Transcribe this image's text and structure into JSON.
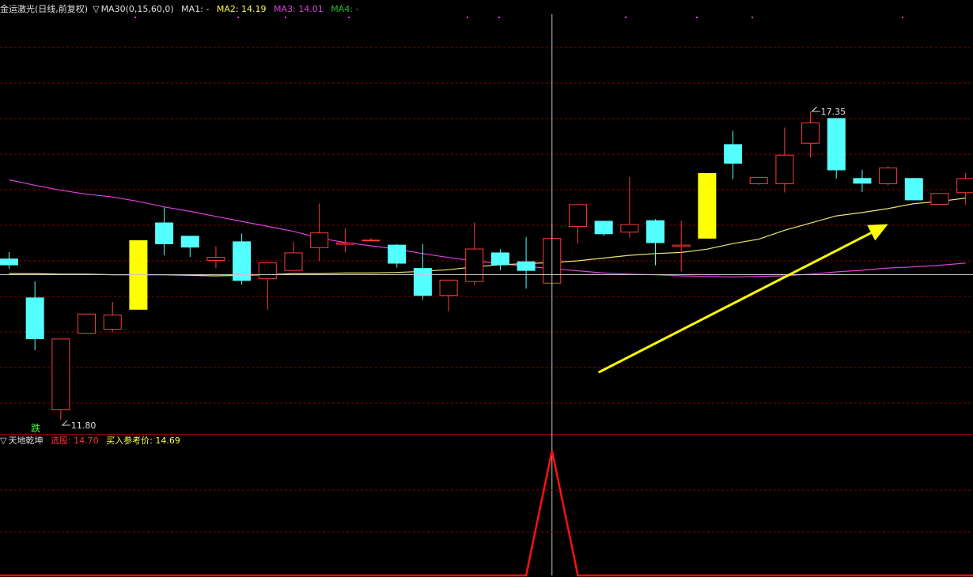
{
  "main_header": {
    "title": "金运激光(日线,前复权)",
    "ma_toggle": "▽",
    "ma_params": "MA30(0,15,60,0)",
    "ma1": "MA1: -",
    "ma2": "MA2: 14.19",
    "ma3": "MA3: 14.01",
    "ma4": "MA4: -"
  },
  "indicator_header": {
    "toggle": "▽",
    "name": "天地乾坤",
    "pick_label": "选股: 14.70",
    "buy_ref_label": "买入参考价: 14.69"
  },
  "annotations": {
    "high_label": "17.35",
    "low_label": "11.80",
    "marker": "跌"
  },
  "colors": {
    "bg": "#000000",
    "grid": "#8b0000",
    "up": "#ff3c3c",
    "down": "#54ffff",
    "big_up": "#ffff00",
    "ma2": "#e8e870",
    "ma3": "#e040e0",
    "ma4": "#20c020",
    "indicator_line": "#ff1010",
    "text_red": "#ff3030",
    "text_yellow": "#ffff40",
    "text_white": "#e0e0e0",
    "marker": "#40ff40"
  },
  "chart_data": [
    {
      "type": "candlestick",
      "price_range": [
        11.6,
        17.6
      ],
      "candles": [
        {
          "o": 14.7,
          "h": 14.82,
          "l": 14.52,
          "c": 14.58
        },
        {
          "o": 14.0,
          "h": 14.29,
          "l": 13.05,
          "c": 13.25
        },
        {
          "o": 11.97,
          "h": 13.26,
          "l": 11.8,
          "c": 13.26
        },
        {
          "o": 13.35,
          "h": 13.7,
          "l": 13.35,
          "c": 13.71
        },
        {
          "o": 13.42,
          "h": 13.92,
          "l": 13.38,
          "c": 13.69
        },
        {
          "o": 13.78,
          "h": 14.99,
          "l": 13.78,
          "c": 15.03
        },
        {
          "o": 15.35,
          "h": 15.62,
          "l": 14.76,
          "c": 14.96
        },
        {
          "o": 15.11,
          "h": 15.11,
          "l": 14.73,
          "c": 14.9
        },
        {
          "o": 14.66,
          "h": 14.92,
          "l": 14.53,
          "c": 14.73
        },
        {
          "o": 15.01,
          "h": 15.15,
          "l": 14.23,
          "c": 14.3
        },
        {
          "o": 14.33,
          "h": 14.63,
          "l": 13.78,
          "c": 14.63
        },
        {
          "o": 14.48,
          "h": 15.0,
          "l": 14.48,
          "c": 14.81
        },
        {
          "o": 14.89,
          "h": 15.69,
          "l": 14.66,
          "c": 15.17
        },
        {
          "o": 14.95,
          "h": 15.25,
          "l": 14.81,
          "c": 14.99
        },
        {
          "o": 15.04,
          "h": 15.07,
          "l": 15.01,
          "c": 15.04
        },
        {
          "o": 14.95,
          "h": 14.96,
          "l": 14.54,
          "c": 14.61
        },
        {
          "o": 14.53,
          "h": 14.96,
          "l": 13.96,
          "c": 14.03
        },
        {
          "o": 14.03,
          "h": 14.32,
          "l": 13.75,
          "c": 14.32
        },
        {
          "o": 14.28,
          "h": 15.35,
          "l": 14.23,
          "c": 14.88
        },
        {
          "o": 14.81,
          "h": 14.87,
          "l": 14.49,
          "c": 14.58
        },
        {
          "o": 14.65,
          "h": 15.09,
          "l": 14.16,
          "c": 14.48
        },
        {
          "o": 14.25,
          "h": 15.32,
          "l": 14.2,
          "c": 15.07
        },
        {
          "o": 15.27,
          "h": 15.53,
          "l": 14.97,
          "c": 15.68
        },
        {
          "o": 15.38,
          "h": 15.36,
          "l": 15.11,
          "c": 15.14
        },
        {
          "o": 15.17,
          "h": 16.17,
          "l": 15.08,
          "c": 15.32
        },
        {
          "o": 15.39,
          "h": 15.41,
          "l": 14.58,
          "c": 14.98
        },
        {
          "o": 14.91,
          "h": 15.38,
          "l": 14.47,
          "c": 14.95
        },
        {
          "o": 15.06,
          "h": 16.24,
          "l": 15.06,
          "c": 16.24
        },
        {
          "o": 16.76,
          "h": 17.0,
          "l": 16.13,
          "c": 16.41
        },
        {
          "o": 16.04,
          "h": 16.16,
          "l": 16.03,
          "c": 16.17
        },
        {
          "o": 16.04,
          "h": 17.06,
          "l": 15.89,
          "c": 16.57
        },
        {
          "o": 16.77,
          "h": 17.35,
          "l": 16.52,
          "c": 17.15
        },
        {
          "o": 17.23,
          "h": 17.23,
          "l": 16.14,
          "c": 16.29
        },
        {
          "o": 16.15,
          "h": 16.3,
          "l": 15.9,
          "c": 16.05
        },
        {
          "o": 16.04,
          "h": 16.36,
          "l": 16.02,
          "c": 16.34
        },
        {
          "o": 16.15,
          "h": 16.15,
          "l": 15.75,
          "c": 15.75
        },
        {
          "o": 15.67,
          "h": 15.85,
          "l": 15.68,
          "c": 15.88
        },
        {
          "o": 15.88,
          "h": 16.24,
          "l": 15.67,
          "c": 16.15
        }
      ],
      "big_up_candles": [
        5,
        27
      ],
      "ma2": [
        14.43,
        14.43,
        14.42,
        14.42,
        14.41,
        14.41,
        14.41,
        14.4,
        14.39,
        14.4,
        14.41,
        14.43,
        14.43,
        14.44,
        14.44,
        14.45,
        14.47,
        14.5,
        14.55,
        14.59,
        14.61,
        14.63,
        14.66,
        14.71,
        14.76,
        14.79,
        14.81,
        14.87,
        14.97,
        15.05,
        15.21,
        15.34,
        15.47,
        15.53,
        15.6,
        15.69,
        15.73,
        15.79
      ],
      "ma3": [
        16.12,
        16.02,
        15.93,
        15.86,
        15.81,
        15.73,
        15.63,
        15.55,
        15.46,
        15.37,
        15.28,
        15.19,
        15.07,
        14.99,
        14.93,
        14.87,
        14.79,
        14.72,
        14.66,
        14.61,
        14.56,
        14.52,
        14.48,
        14.44,
        14.42,
        14.41,
        14.39,
        14.38,
        14.37,
        14.38,
        14.39,
        14.42,
        14.46,
        14.49,
        14.53,
        14.55,
        14.58,
        14.62
      ],
      "crosshair": {
        "index": 21,
        "price": 14.41
      },
      "arrow": {
        "from": {
          "index": 22.8,
          "price": 12.65
        },
        "to": {
          "index": 34,
          "price": 15.32
        }
      }
    },
    {
      "type": "line",
      "name": "天地乾坤",
      "values": [
        0,
        0,
        0,
        0,
        0,
        0,
        0,
        0,
        0,
        0,
        0,
        0,
        0,
        0,
        0,
        0,
        0,
        0,
        0,
        0,
        0,
        1,
        0,
        0,
        0,
        0,
        0,
        0,
        0,
        0,
        0,
        0,
        0,
        0,
        0,
        0,
        0,
        0
      ]
    }
  ]
}
